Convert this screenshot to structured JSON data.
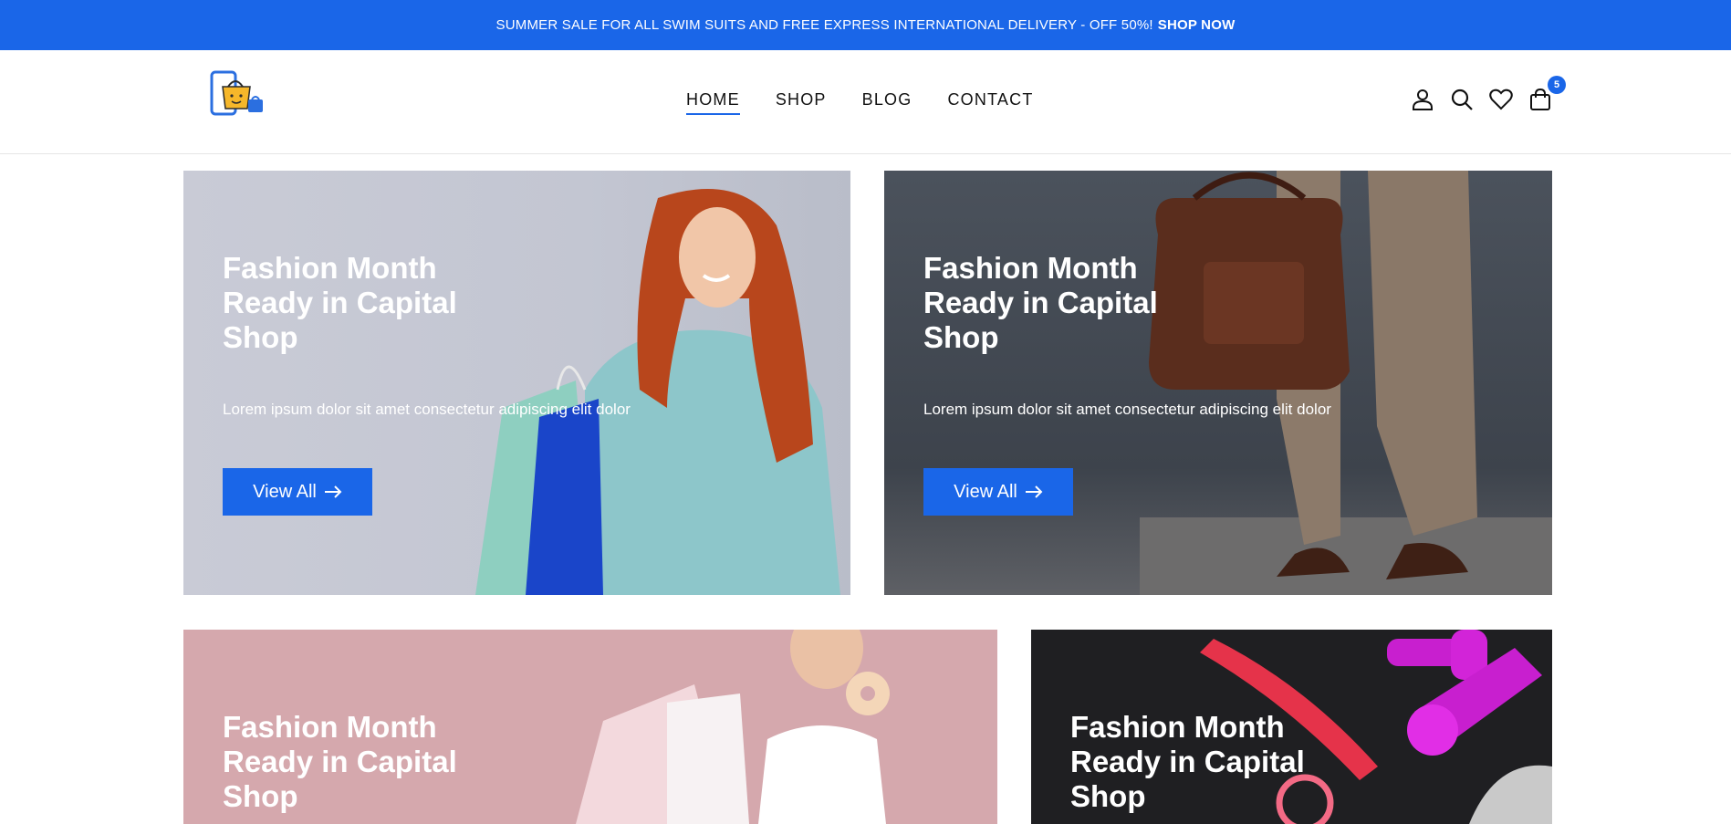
{
  "promo": {
    "text": "SUMMER SALE FOR ALL SWIM SUITS AND FREE EXPRESS INTERNATIONAL DELIVERY - OFF 50%!",
    "cta": "SHOP NOW"
  },
  "nav": {
    "items": [
      {
        "label": "HOME",
        "active": true
      },
      {
        "label": "SHOP",
        "active": false
      },
      {
        "label": "BLOG",
        "active": false
      },
      {
        "label": "CONTACT",
        "active": false
      }
    ]
  },
  "header_icons": {
    "icons": [
      "user-icon",
      "search-icon",
      "heart-icon",
      "shopping-bag-icon"
    ],
    "cart_count": "5"
  },
  "banners": [
    {
      "title": "Fashion Month Ready in Capital Shop",
      "description": "Lorem ipsum dolor sit amet consectetur adipiscing elit dolor",
      "button": "View All"
    },
    {
      "title": "Fashion Month Ready in Capital Shop",
      "description": "Lorem ipsum dolor sit amet consectetur adipiscing elit dolor",
      "button": "View All"
    },
    {
      "title": "Fashion Month Ready in Capital Shop"
    },
    {
      "title": "Fashion Month Ready in Capital Shop"
    }
  ],
  "colors": {
    "accent": "#1a66e8"
  }
}
